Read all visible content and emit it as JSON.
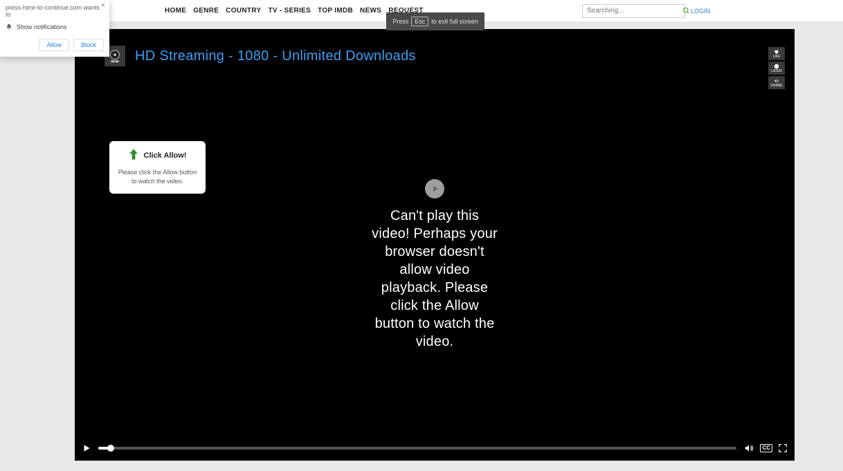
{
  "nav": {
    "items": [
      "HOME",
      "GENRE",
      "COUNTRY",
      "TV - SERIES",
      "TOP IMDb",
      "NEWS",
      "REQUEST"
    ]
  },
  "search": {
    "placeholder": "Searching..."
  },
  "login_label": "LOGIN",
  "fs_hint": {
    "pre": "Press",
    "key": "Esc",
    "post": "to exit full screen"
  },
  "notif": {
    "line1": "press-here-to-continue.com wants to",
    "line2": "Show notifications",
    "allow": "Allow",
    "block": "Block"
  },
  "stream_title": "HD Streaming - 1080 - Unlimited Downloads",
  "hd_badge": "HD",
  "side_actions": [
    {
      "icon": "heart",
      "label": "LIKE"
    },
    {
      "icon": "clock",
      "label": "LATER"
    },
    {
      "icon": "share",
      "label": "SHARE"
    }
  ],
  "allow_tip": {
    "title": "Click Allow!",
    "sub": "Please click the Allow button to watch the video."
  },
  "error_msg": "Can't play this video! Perhaps your browser doesn't allow video playback. Please click the Allow button to watch the video.",
  "controls": {
    "cc": "CC"
  }
}
